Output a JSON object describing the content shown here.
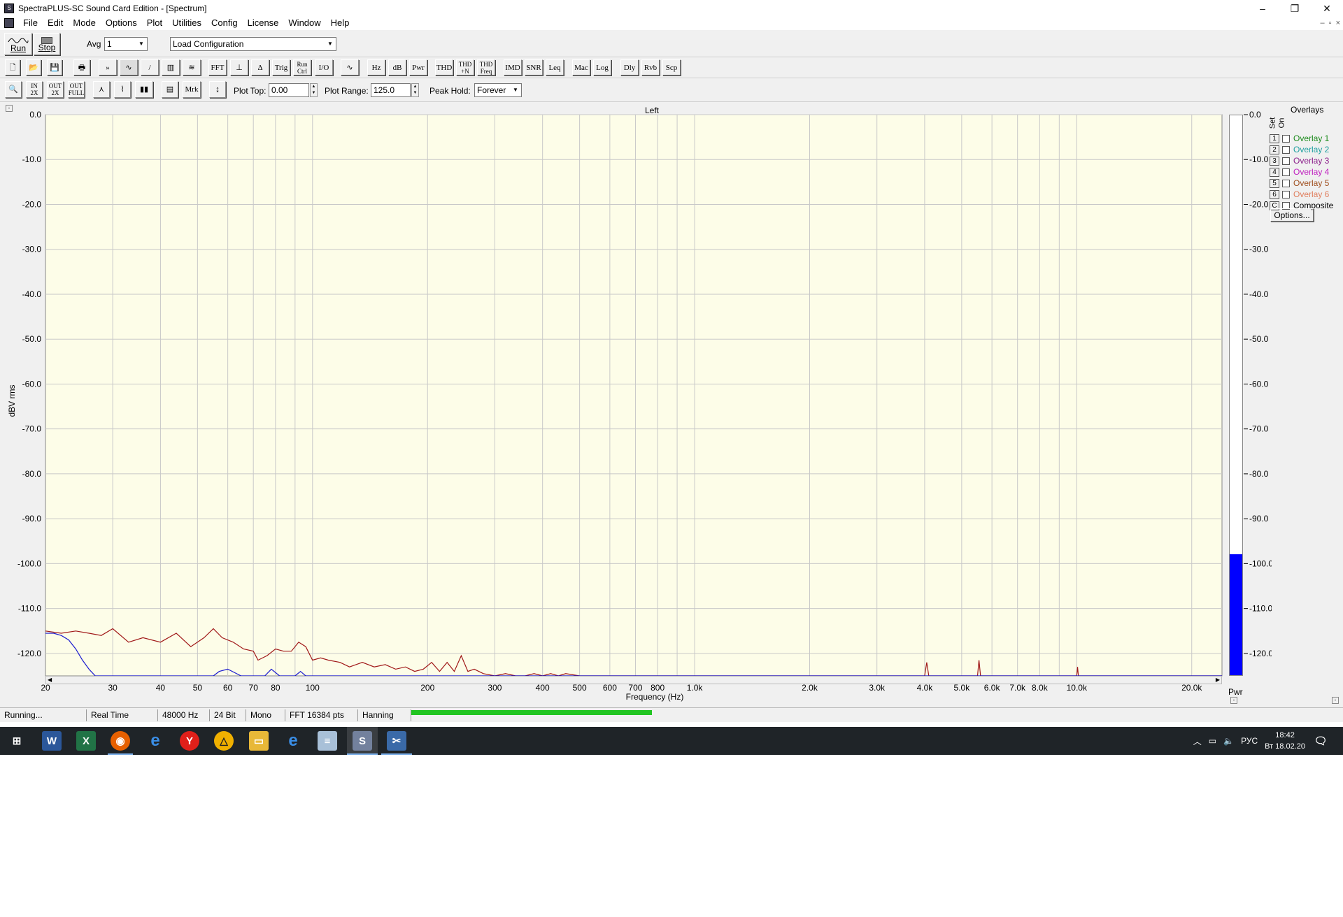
{
  "window": {
    "title": "SpectraPLUS-SC Sound Card Edition - [Spectrum]",
    "controls": [
      "–",
      "❐",
      "✕"
    ]
  },
  "menu": [
    "File",
    "Edit",
    "Mode",
    "Options",
    "Plot",
    "Utilities",
    "Config",
    "License",
    "Window",
    "Help"
  ],
  "mdi_controls": [
    "–",
    "▫",
    "×"
  ],
  "toolbar1": {
    "run_label": "Run",
    "stop_label": "Stop",
    "avg_label": "Avg",
    "avg_value": "1",
    "config_value": "Load Configuration"
  },
  "toolbar2": {
    "buttons": [
      "FFT",
      "Trig",
      "Run Ctrl",
      "I/O",
      "Hz",
      "dB",
      "Pwr",
      "THD",
      "THD +N",
      "THD Freq",
      "IMD",
      "SNR",
      "Leq",
      "Mac",
      "Log",
      "Dly",
      "Rvb",
      "Scp"
    ]
  },
  "toolbar3": {
    "zoom_in": "IN 2X",
    "zoom_out": "OUT 2X",
    "zoom_full": "OUT FULL",
    "mrk": "Mrk",
    "plot_top_label": "Plot Top:",
    "plot_top_value": "0.00",
    "plot_range_label": "Plot Range:",
    "plot_range_value": "125.0",
    "peak_hold_label": "Peak Hold:",
    "peak_hold_value": "Forever"
  },
  "overlays": {
    "title": "Overlays",
    "col_set": "Set",
    "col_on": "On",
    "items": [
      {
        "num": "1",
        "label": "Overlay 1",
        "color": "#1e8c1e"
      },
      {
        "num": "2",
        "label": "Overlay 2",
        "color": "#20a0a0"
      },
      {
        "num": "3",
        "label": "Overlay 3",
        "color": "#8a1e8a"
      },
      {
        "num": "4",
        "label": "Overlay 4",
        "color": "#c020c0"
      },
      {
        "num": "5",
        "label": "Overlay 5",
        "color": "#a05020"
      },
      {
        "num": "6",
        "label": "Overlay 6",
        "color": "#e08060"
      },
      {
        "num": "C",
        "label": "Composite",
        "color": "#000000"
      }
    ],
    "options_label": "Options..."
  },
  "meter_label": "Pwr",
  "meter_level_db": -98,
  "status": {
    "state": "Running...",
    "mode": "Real Time",
    "rate": "48000 Hz",
    "bits": "24 Bit",
    "channels": "Mono",
    "fft": "FFT 16384 pts",
    "window": "Hanning",
    "progress": 0.5
  },
  "taskbar": {
    "lang": "РУС",
    "time": "18:42",
    "date": "Вт 18.02.20"
  },
  "chart_data": {
    "type": "line",
    "title": "Left",
    "xlabel": "Frequency (Hz)",
    "ylabel": "dBV rms",
    "xscale": "log",
    "xlim": [
      20,
      24000
    ],
    "ylim": [
      -125,
      0
    ],
    "grid": true,
    "yticks": [
      "0.0",
      "-10.0",
      "-20.0",
      "-30.0",
      "-40.0",
      "-50.0",
      "-60.0",
      "-70.0",
      "-80.0",
      "-90.0",
      "-100.0",
      "-110.0",
      "-120.0"
    ],
    "ytick_values": [
      0,
      -10,
      -20,
      -30,
      -40,
      -50,
      -60,
      -70,
      -80,
      -90,
      -100,
      -110,
      -120
    ],
    "xticks": [
      "20",
      "30",
      "40",
      "50",
      "60",
      "70",
      "80",
      "100",
      "200",
      "300",
      "400",
      "500",
      "600",
      "700",
      "800",
      "1.0k",
      "2.0k",
      "3.0k",
      "4.0k",
      "5.0k",
      "6.0k",
      "7.0k",
      "8.0k",
      "10.0k",
      "20.0k"
    ],
    "xtick_values": [
      20,
      30,
      40,
      50,
      60,
      70,
      80,
      100,
      200,
      300,
      400,
      500,
      600,
      700,
      800,
      1000,
      2000,
      3000,
      4000,
      5000,
      6000,
      7000,
      8000,
      10000,
      20000
    ],
    "series": [
      {
        "color": "#a01818",
        "x": [
          20,
          22,
          24,
          26,
          28,
          30,
          33,
          36,
          40,
          44,
          48,
          52,
          55,
          58,
          62,
          66,
          70,
          72,
          76,
          80,
          84,
          88,
          92,
          96,
          100,
          105,
          110,
          118,
          125,
          135,
          145,
          155,
          165,
          175,
          185,
          195,
          205,
          215,
          225,
          235,
          245,
          255,
          265,
          280,
          300,
          320,
          340,
          360,
          380,
          400,
          420,
          440,
          460,
          500,
          600,
          700,
          800,
          1000,
          1400,
          2000,
          4000,
          4050,
          4100,
          5500,
          5550,
          5600,
          10000,
          10050,
          10100,
          20000,
          24000
        ],
        "y": [
          -115,
          -115.5,
          -115,
          -115.5,
          -116,
          -114.5,
          -117.5,
          -116.5,
          -117.5,
          -115.5,
          -118.5,
          -116.5,
          -114.5,
          -116.5,
          -117.5,
          -119,
          -119.5,
          -121.5,
          -120.5,
          -119,
          -119.5,
          -119.5,
          -117.5,
          -118.5,
          -121.5,
          -121,
          -121.5,
          -122,
          -123,
          -122,
          -123,
          -122.5,
          -123.5,
          -123,
          -124,
          -123.5,
          -122,
          -124,
          -122,
          -124,
          -120.5,
          -124,
          -123.5,
          -124.5,
          -125,
          -124.5,
          -125,
          -125,
          -124.5,
          -125,
          -124.5,
          -125,
          -124.5,
          -125,
          -125,
          -125,
          -125,
          -125,
          -125,
          -125,
          -125,
          -122,
          -125,
          -125,
          -121.5,
          -125,
          -125,
          -123,
          -125,
          -125,
          -125
        ]
      },
      {
        "color": "#1a1ad0",
        "x": [
          20,
          21,
          22,
          23,
          24,
          25,
          26,
          27,
          28,
          30,
          40,
          55,
          57,
          60,
          65,
          75,
          78,
          82,
          90,
          93,
          96,
          100,
          24000
        ],
        "y": [
          -115.5,
          -115.5,
          -116,
          -117,
          -119,
          -121.5,
          -123.5,
          -125,
          -125,
          -125,
          -125,
          -125,
          -124,
          -123.5,
          -125,
          -125,
          -123.5,
          -125,
          -125,
          -124,
          -125,
          -125,
          -125
        ]
      }
    ]
  }
}
